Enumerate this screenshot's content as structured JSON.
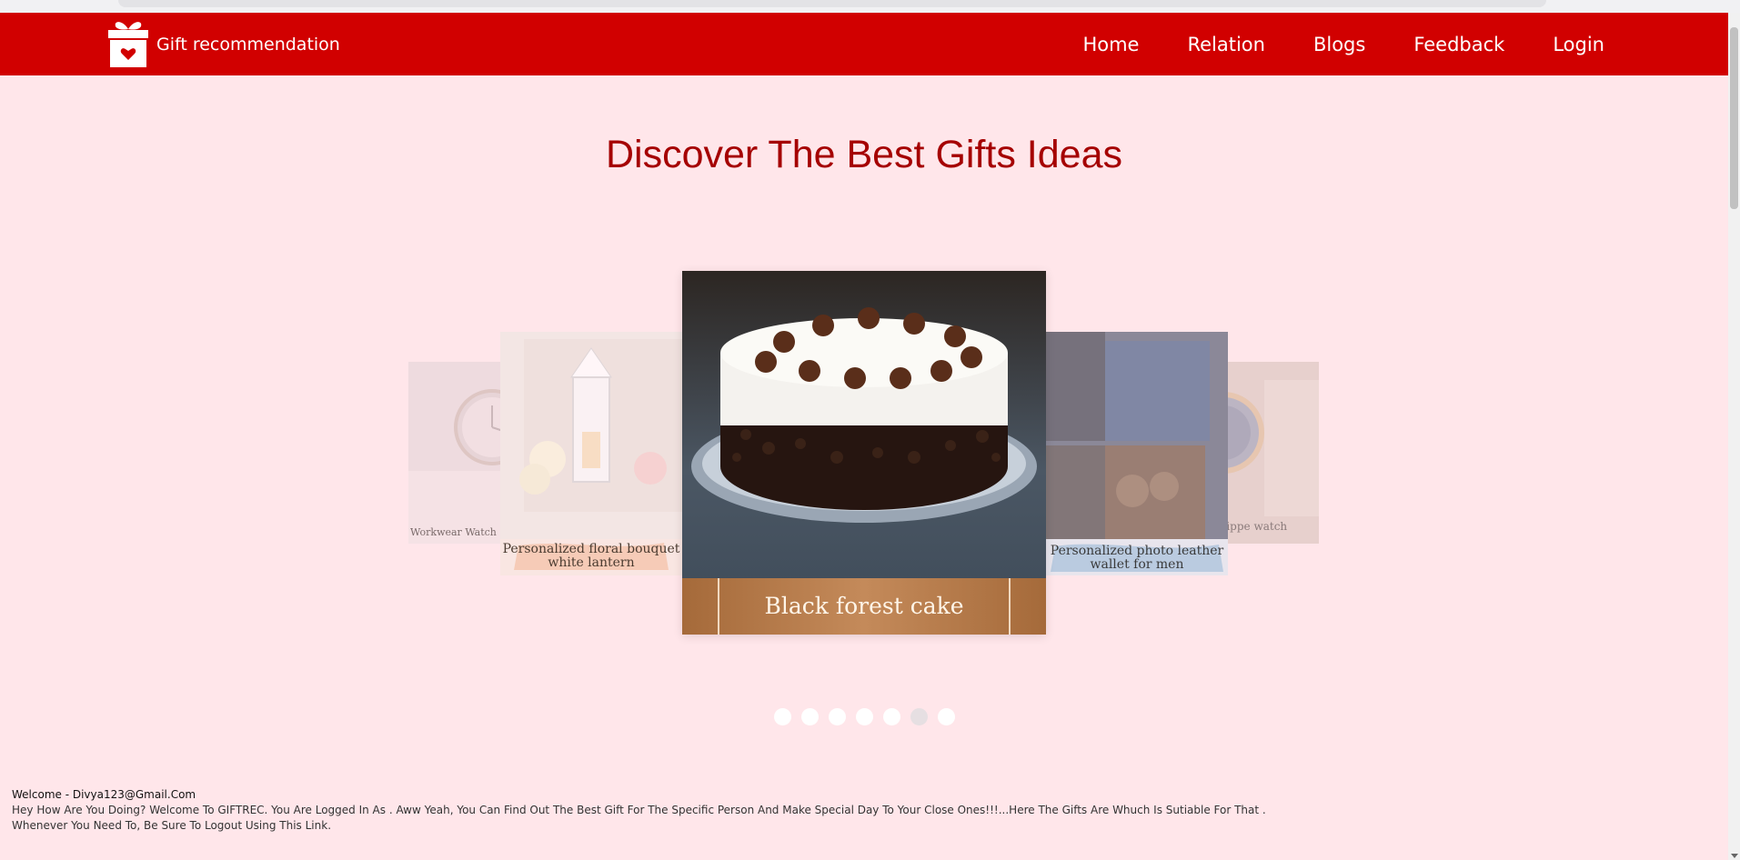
{
  "brand": {
    "name": "Gift recommendation",
    "logo_icon": "gift-heart-icon",
    "brand_color": "#d10000"
  },
  "nav": {
    "items": [
      {
        "label": "Home"
      },
      {
        "label": "Relation"
      },
      {
        "label": "Blogs"
      },
      {
        "label": "Feedback"
      },
      {
        "label": "Login"
      }
    ]
  },
  "hero": {
    "title": "Discover The Best Gifts Ideas",
    "title_color": "#a50000"
  },
  "carousel": {
    "cards": [
      {
        "caption": "Workwear Watch ... Leather"
      },
      {
        "caption": "Personalized floral bouquet white lantern"
      },
      {
        "caption": "Black forest cake"
      },
      {
        "caption": "Personalized photo leather wallet for men"
      },
      {
        "caption": "Philippe watch"
      }
    ],
    "dots": 7,
    "active_dot": 6
  },
  "footer": {
    "welcome": "Welcome - Divya123@Gmail.Com",
    "line1": "Hey How Are You Doing? Welcome To GIFTREC. You Are Logged In As . Aww Yeah, You Can Find Out The Best Gift For The Specific Person And Make Special Day To Your Close Ones!!!...Here The Gifts Are Whuch Is Sutiable For That .",
    "line2": "Whenever You Need To, Be Sure To Logout Using This Link."
  }
}
